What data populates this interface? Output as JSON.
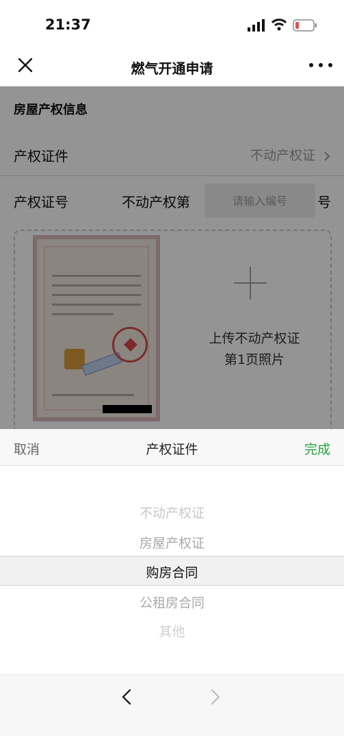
{
  "status_bar": {
    "time": "21:37",
    "icons": [
      "signal-icon",
      "wifi-icon",
      "battery-icon"
    ],
    "battery_color": "#e05252"
  },
  "nav": {
    "title": "燃气开通申请",
    "left_icon": "close-icon",
    "right_icon": "more-icon"
  },
  "form": {
    "section_title": "房屋产权信息",
    "cert_type": {
      "label": "产权证件",
      "value": "不动产权证"
    },
    "cert_number": {
      "label": "产权证号",
      "prefix": "不动产权第",
      "placeholder": "请输入编号",
      "suffix": "号"
    },
    "upload": {
      "line1": "上传不动产权证",
      "line2": "第1页照片"
    }
  },
  "picker_sheet": {
    "cancel_label": "取消",
    "title": "产权证件",
    "done_label": "完成",
    "done_color": "#26a33d",
    "options": [
      "不动产权证",
      "房屋产权证",
      "购房合同",
      "公租房合同",
      "其他"
    ],
    "selected": "购房合同"
  },
  "footer": {
    "icons": [
      "chevron-left-icon",
      "chevron-right-icon"
    ]
  }
}
